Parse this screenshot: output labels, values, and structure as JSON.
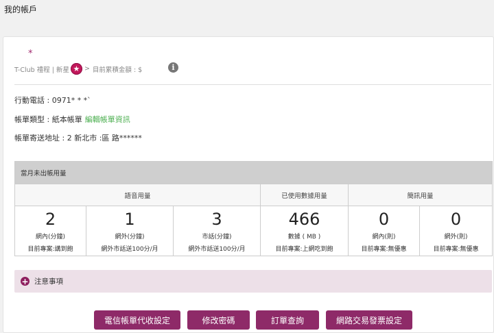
{
  "page": {
    "title": "我的帳戶"
  },
  "tclub": {
    "asterisk": "*",
    "label": "T-Club 禮程 | 新星",
    "badge_icon": "star-icon",
    "separator": ">",
    "points_label": "目前累積金額 : $",
    "info_icon": "info-icon"
  },
  "account": {
    "phone": "行動電話 : 0971*  *  *ˋ",
    "bill_type": "帳單類型 : 紙本帳單",
    "edit_bill_link": "編輯帳單資訊",
    "address": "帳單寄送地址 : 2    新北市        :區         路******"
  },
  "usage": {
    "title": "當月未出帳用量",
    "groups": {
      "voice": "語音用量",
      "data": "已使用數據用量",
      "sms": "簡訊用量"
    },
    "cells": [
      {
        "value": "2",
        "label": "網內(分鐘)",
        "plan": "目前專案:講到飽"
      },
      {
        "value": "1",
        "label": "網外(分鐘)",
        "plan": "網外市話送100分/月"
      },
      {
        "value": "3",
        "label": "市話(分鐘)",
        "plan": "網外市話送100分/月"
      },
      {
        "value": "466",
        "label": "數據 ( MB )",
        "plan": "目前專案:上網吃到飽"
      },
      {
        "value": "0",
        "label": "網內(則)",
        "plan": "目前專案:無優惠"
      },
      {
        "value": "0",
        "label": "網外(則)",
        "plan": "目前專案:無優惠"
      }
    ]
  },
  "notice": {
    "label": "注意事項",
    "icon": "plus-circle-icon"
  },
  "buttons": {
    "telecom_billing": "電信帳單代收設定",
    "change_password": "修改密碼",
    "order_query": "訂單查詢",
    "invoice_settings": "網路交易發票設定"
  },
  "colors": {
    "accent": "#8e2a68",
    "link": "#4caf50",
    "badge": "#c2185b"
  }
}
